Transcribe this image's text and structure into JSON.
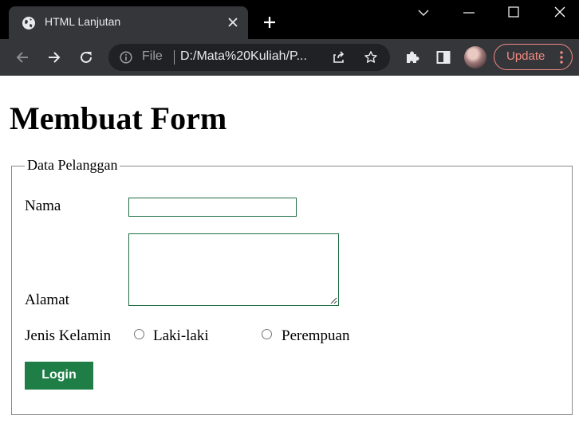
{
  "browser": {
    "tab_title": "HTML Lanjutan",
    "omnibox_scheme": "File",
    "url": "D:/Mata%20Kuliah/P...",
    "update_label": "Update"
  },
  "page": {
    "heading": "Membuat Form",
    "fieldset_legend": "Data Pelanggan",
    "nama_label": "Nama",
    "nama_value": "",
    "alamat_label": "Alamat",
    "alamat_value": "",
    "gender_label": "Jenis Kelamin",
    "gender_options": [
      "Laki-laki",
      "Perempuan"
    ],
    "submit_label": "Login"
  },
  "colors": {
    "accent_button": "#1e7e46",
    "update_outline": "#f28b82"
  }
}
